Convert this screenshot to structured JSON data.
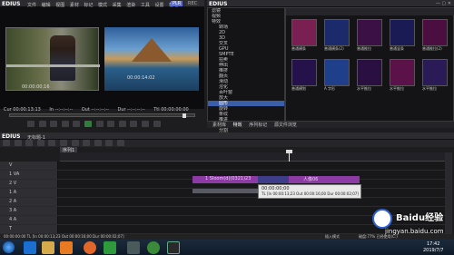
{
  "player_window": {
    "app_title": "EDIUS",
    "menu": [
      "文件",
      "编辑",
      "视图",
      "素材",
      "标记",
      "模式",
      "采集",
      "渲染",
      "工具",
      "设置",
      "帮助"
    ],
    "badge": "PLR",
    "badge_rec": "REC",
    "left_timecode": "00:00:00;16",
    "right_timecode": "00:00:14:02",
    "cue_in_label": "Cur 00:00:13:13",
    "cue_in": "In --:--:--:--",
    "cue_out": "Out --:--:--:--",
    "cue_dur": "Dur --:--:--:--",
    "cue_ttl": "Ttl 00:00:00:00"
  },
  "effect_window": {
    "app_title": "EDIUS",
    "tree_items": [
      "滤镜",
      "视频",
      "特效",
      "转场",
      "2D",
      "3D",
      "交叉",
      "GPU",
      "SMPTE",
      "拍卖",
      "伸出",
      "推挤",
      "翻页",
      "滑动",
      "溶化",
      "百叶窗",
      "放大",
      "圆形",
      "旋转",
      "条纹",
      "推进",
      "拉伸",
      "分割",
      "双侧"
    ],
    "thumbnails": [
      {
        "label": "普通横条",
        "color": "#7a1f52"
      },
      {
        "label": "普通横条(2)",
        "color": "#1b2a6b"
      },
      {
        "label": "普通推拉",
        "color": "#3b1045"
      },
      {
        "label": "普通竖条",
        "color": "#1a1a55"
      },
      {
        "label": "普通推拉(2)",
        "color": "#4a0f40"
      },
      {
        "label": "普通横划",
        "color": "#26124a"
      },
      {
        "label": "A 字形",
        "color": "#1f3f8a"
      },
      {
        "label": "水平推拉",
        "color": "#2a1040"
      },
      {
        "label": "水平推拉",
        "color": "#5a1248"
      },
      {
        "label": "水平推拉",
        "color": "#2a1a55"
      }
    ],
    "tabs": [
      "素材库",
      "特效",
      "序列标记",
      "源文件浏览"
    ]
  },
  "timeline_window": {
    "app_title": "EDIUS",
    "project": "无标题-1",
    "sequence_tab": "序列1",
    "tracks": [
      "V",
      "1 VA",
      "2 V",
      "1 A",
      "2 A",
      "3 A",
      "4 A",
      "T"
    ],
    "clip1_label": "1 Sloom(d)(0321)23",
    "clip2_label": "人像06",
    "tooltip_line1": "00:00:00;00",
    "tooltip_line2": "TL [In 00:00:13;23 Out 00:00:16;00 Dur 00:00:02;07]",
    "status_left": "00:00:00:00 TL [In 00:00:13;23 Out 00:00:16;00 Dur 00:00:02;07]",
    "status_mode": "插入模式",
    "status_disk": "磁盘:77% 已经使用(C:)"
  },
  "taskbar": {
    "time": "17:42",
    "date": "2019/7/7"
  },
  "watermark": {
    "site": "Baidu经验",
    "url": "jingyan.baidu.com"
  }
}
